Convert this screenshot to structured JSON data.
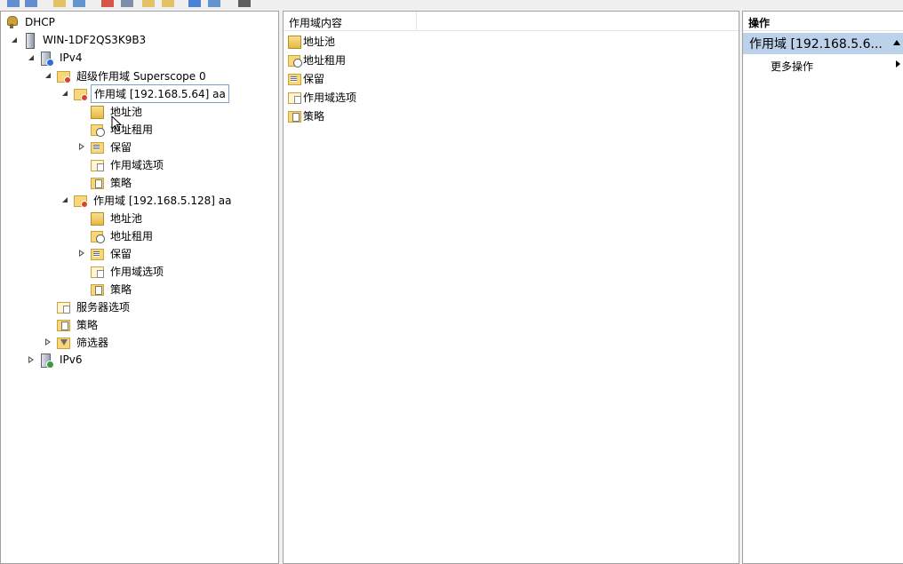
{
  "toolbar": {
    "icons": [
      "back-icon",
      "forward-icon",
      "folder-icon",
      "console-tree-icon",
      "delete-icon",
      "properties-icon",
      "refresh-icon",
      "export-icon",
      "help-icon",
      "show-hide-icon",
      "info-icon"
    ]
  },
  "tree": {
    "items": [
      {
        "label": "DHCP",
        "icon": "dhcp",
        "depth": 0,
        "expander": "none"
      },
      {
        "label": "WIN-1DF2QS3K9B3",
        "icon": "server",
        "depth": 1,
        "expander": "open"
      },
      {
        "label": "IPv4",
        "icon": "ipv4",
        "depth": 2,
        "expander": "open"
      },
      {
        "label": "超级作用域 Superscope 0",
        "icon": "scope",
        "depth": 3,
        "expander": "open"
      },
      {
        "label": "作用域 [192.168.5.64] aa",
        "icon": "scope",
        "depth": 4,
        "expander": "open",
        "selected": true
      },
      {
        "label": "地址池",
        "icon": "pool",
        "depth": 5,
        "expander": "none"
      },
      {
        "label": "地址租用",
        "icon": "lease",
        "depth": 5,
        "expander": "none"
      },
      {
        "label": "保留",
        "icon": "reserve",
        "depth": 5,
        "expander": "closed"
      },
      {
        "label": "作用域选项",
        "icon": "options",
        "depth": 5,
        "expander": "none"
      },
      {
        "label": "策略",
        "icon": "policy",
        "depth": 5,
        "expander": "none"
      },
      {
        "label": "作用域 [192.168.5.128] aa",
        "icon": "scope",
        "depth": 4,
        "expander": "open"
      },
      {
        "label": "地址池",
        "icon": "pool",
        "depth": 5,
        "expander": "none"
      },
      {
        "label": "地址租用",
        "icon": "lease",
        "depth": 5,
        "expander": "none"
      },
      {
        "label": "保留",
        "icon": "reserve",
        "depth": 5,
        "expander": "closed"
      },
      {
        "label": "作用域选项",
        "icon": "options",
        "depth": 5,
        "expander": "none"
      },
      {
        "label": "策略",
        "icon": "policy",
        "depth": 5,
        "expander": "none"
      },
      {
        "label": "服务器选项",
        "icon": "options",
        "depth": 3,
        "expander": "none"
      },
      {
        "label": "策略",
        "icon": "policy",
        "depth": 3,
        "expander": "none"
      },
      {
        "label": "筛选器",
        "icon": "filter",
        "depth": 3,
        "expander": "closed"
      },
      {
        "label": "IPv6",
        "icon": "ipv6",
        "depth": 2,
        "expander": "closed"
      }
    ]
  },
  "content": {
    "column_header": "作用域内容",
    "items": [
      {
        "label": "地址池",
        "icon": "pool"
      },
      {
        "label": "地址租用",
        "icon": "lease"
      },
      {
        "label": "保留",
        "icon": "reserve"
      },
      {
        "label": "作用域选项",
        "icon": "options"
      },
      {
        "label": "策略",
        "icon": "policy"
      }
    ]
  },
  "actions": {
    "header": "操作",
    "section_title": "作用域 [192.168.5.6...",
    "more_actions": "更多操作"
  }
}
